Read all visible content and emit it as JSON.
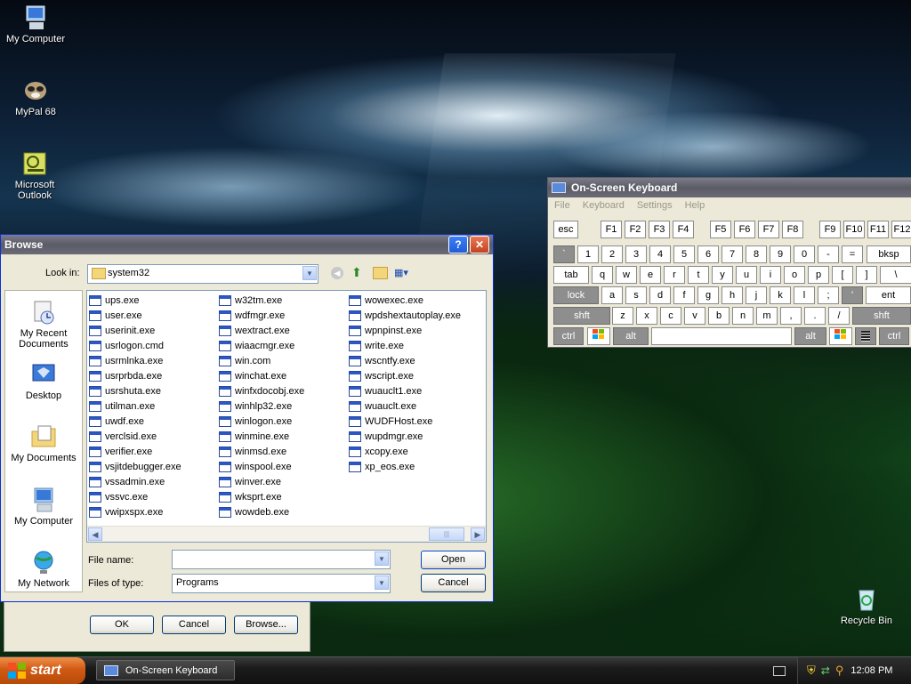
{
  "desktop": {
    "icons": [
      {
        "label": "My Computer",
        "icon": "computer-icon"
      },
      {
        "label": "MyPal 68",
        "icon": "mypal-icon"
      },
      {
        "label": "Microsoft Outlook",
        "icon": "outlook-icon"
      },
      {
        "label": "Recycle Bin",
        "icon": "recycle-bin-icon"
      }
    ]
  },
  "browse": {
    "title": "Browse",
    "look_in_label": "Look in:",
    "look_in_value": "system32",
    "places": [
      "My Recent Documents",
      "Desktop",
      "My Documents",
      "My Computer",
      "My Network"
    ],
    "columns": [
      [
        "ups.exe",
        "user.exe",
        "userinit.exe",
        "usrlogon.cmd",
        "usrmlnka.exe",
        "usrprbda.exe",
        "usrshuta.exe",
        "utilman.exe",
        "uwdf.exe",
        "verclsid.exe",
        "verifier.exe",
        "vsjitdebugger.exe",
        "vssadmin.exe",
        "vssvc.exe",
        "vwipxspx.exe"
      ],
      [
        "w32tm.exe",
        "wdfmgr.exe",
        "wextract.exe",
        "wiaacmgr.exe",
        "win.com",
        "winchat.exe",
        "winfxdocobj.exe",
        "winhlp32.exe",
        "winlogon.exe",
        "winmine.exe",
        "winmsd.exe",
        "winspool.exe",
        "winver.exe",
        "wksprt.exe",
        "wowdeb.exe"
      ],
      [
        "wowexec.exe",
        "wpdshextautoplay.exe",
        "wpnpinst.exe",
        "write.exe",
        "wscntfy.exe",
        "wscript.exe",
        "wuauclt1.exe",
        "wuauclt.exe",
        "WUDFHost.exe",
        "wupdmgr.exe",
        "xcopy.exe",
        "xp_eos.exe"
      ]
    ],
    "file_name_label": "File name:",
    "file_name_value": "",
    "files_of_type_label": "Files of type:",
    "files_of_type_value": "Programs",
    "open_label": "Open",
    "cancel_label": "Cancel"
  },
  "backdialog": {
    "ok_label": "OK",
    "cancel_label": "Cancel",
    "browse_label": "Browse..."
  },
  "osk": {
    "title": "On-Screen Keyboard",
    "menu": [
      "File",
      "Keyboard",
      "Settings",
      "Help"
    ],
    "rows": {
      "r1": [
        "esc",
        "F1",
        "F2",
        "F3",
        "F4",
        "F5",
        "F6",
        "F7",
        "F8",
        "F9",
        "F10",
        "F11",
        "F12"
      ],
      "r2": [
        "`",
        "1",
        "2",
        "3",
        "4",
        "5",
        "6",
        "7",
        "8",
        "9",
        "0",
        "-",
        "=",
        "bksp"
      ],
      "r3": [
        "tab",
        "q",
        "w",
        "e",
        "r",
        "t",
        "y",
        "u",
        "i",
        "o",
        "p",
        "[",
        "]",
        "\\"
      ],
      "r4": [
        "lock",
        "a",
        "s",
        "d",
        "f",
        "g",
        "h",
        "j",
        "k",
        "l",
        ";",
        "'",
        "ent"
      ],
      "r5": [
        "shft",
        "z",
        "x",
        "c",
        "v",
        "b",
        "n",
        "m",
        ",",
        ".",
        "/",
        "shft"
      ],
      "r6": [
        "ctrl",
        "alt",
        "alt",
        "ctrl"
      ]
    }
  },
  "taskbar": {
    "start_label": "start",
    "task_label": "On-Screen Keyboard",
    "clock": "12:08 PM"
  }
}
